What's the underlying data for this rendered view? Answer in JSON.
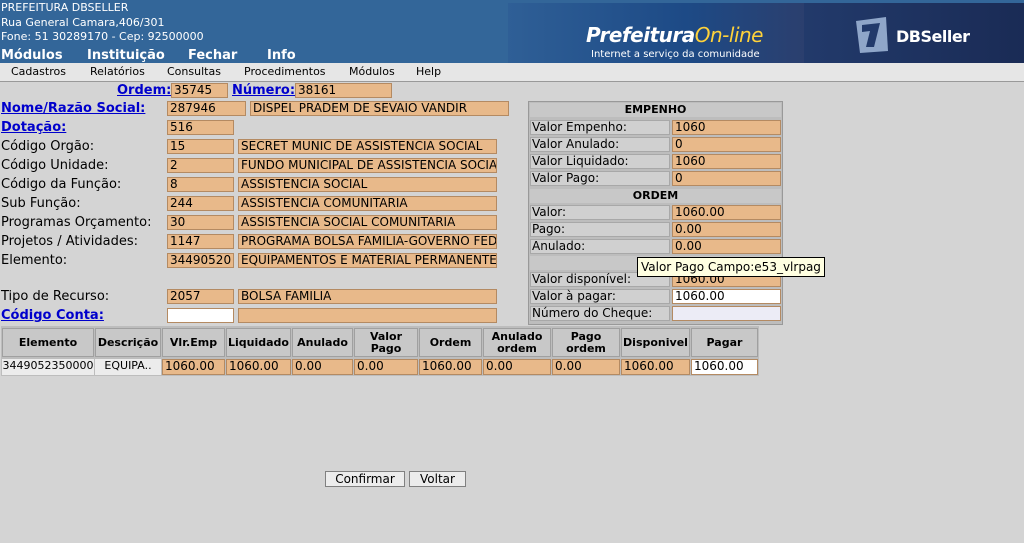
{
  "header": {
    "org_name": "PREFEITURA DBSELLER",
    "address": "Rua General Camara,406/301",
    "phone_line": "Fone: 51 30289170  -  Cep: 92500000",
    "top_menu": [
      "Módulos",
      "Instituição",
      "Fechar",
      "Info"
    ],
    "banner_prefix": "Prefeitura",
    "banner_suffix": "On-line",
    "banner_tagline": "Internet a serviço da comunidade",
    "brand": "DBSeller"
  },
  "menubar": [
    "Cadastros",
    "Relatórios",
    "Consultas",
    "Procedimentos",
    "Módulos",
    "Help"
  ],
  "form": {
    "ordem_label": "Ordem:",
    "ordem_value": "35745",
    "numero_label": "Número:",
    "numero_value": "38161",
    "nome_label": "Nome/Razão Social:",
    "nome_code": "287946",
    "nome_value": "DISPEL PRADEM DE SEVAIO VANDIR",
    "dotacao_label": "Dotação:",
    "dotacao_value": "516",
    "orgao_label": "Código Orgão:",
    "orgao_code": "15",
    "orgao_value": "SECRET MUNIC DE ASSISTÊNCIA SOCIAL",
    "unidade_label": "Código Unidade:",
    "unidade_code": "2",
    "unidade_value": "FUNDO MUNICIPAL DE ASSISTENCIA SOCIAL",
    "funcao_label": "Código da Função:",
    "funcao_code": "8",
    "funcao_value": "ASSISTÊNCIA SOCIAL",
    "subfuncao_label": "Sub Função:",
    "subfuncao_code": "244",
    "subfuncao_value": "ASSISTÊNCIA COMUNITÁRIA",
    "programas_label": "Programas Orçamento:",
    "programas_code": "30",
    "programas_value": "ASSISTENCIA SOCIAL COMUNITARIA",
    "projetos_label": "Projetos / Atividades:",
    "projetos_code": "1147",
    "projetos_value": "PROGRAMA BOLSA FAMILIA-GOVERNO FEDE",
    "elemento_label": "Elemento:",
    "elemento_code": "34490520",
    "elemento_value": "EQUIPAMENTOS E MATERIAL PERMANENTE",
    "recurso_label": "Tipo de Recurso:",
    "recurso_code": "2057",
    "recurso_value": "BOLSA FAMÍLIA",
    "conta_label": "Código Conta:",
    "conta_code": "",
    "conta_value": ""
  },
  "panel": {
    "empenho_title": "EMPENHO",
    "valor_empenho_label": "Valor Empenho:",
    "valor_empenho": "1060",
    "valor_anulado_label": "Valor Anulado:",
    "valor_anulado": "0",
    "valor_liquidado_label": "Valor Liquidado:",
    "valor_liquidado": "1060",
    "valor_pago_label": "Valor Pago:",
    "valor_pago": "0",
    "ordem_title": "ORDEM",
    "valor_label": "Valor:",
    "valor": "1060.00",
    "pago_label": "Pago:",
    "pago": "0.00",
    "anulado_label": "Anulado:",
    "anulado": "0.00",
    "disponivel_label": "Valor disponível:",
    "disponivel": "1060.00",
    "a_pagar_label": "Valor à pagar:",
    "a_pagar": "1060.00",
    "cheque_label": "Número do Cheque:",
    "cheque": ""
  },
  "tooltip": "Valor Pago Campo:e53_vlrpag",
  "table": {
    "headers": [
      "Elemento",
      "Descrição",
      "Vlr.Emp",
      "Liquidado",
      "Anulado",
      "Valor Pago",
      "Ordem",
      "Anulado ordem",
      "Pago ordem",
      "Disponivel",
      "Pagar"
    ],
    "row": [
      "3449052350000",
      "EQUIPA..",
      "1060.00",
      "1060.00",
      "0.00",
      "0.00",
      "1060.00",
      "0.00",
      "0.00",
      "1060.00",
      "1060.00"
    ]
  },
  "buttons": {
    "confirmar": "Confirmar",
    "voltar": "Voltar"
  },
  "colors": {
    "header_bg": "#336699",
    "field_bg": "#e8b98a",
    "page_bg": "#d4d4d4",
    "link": "#0000cc"
  }
}
